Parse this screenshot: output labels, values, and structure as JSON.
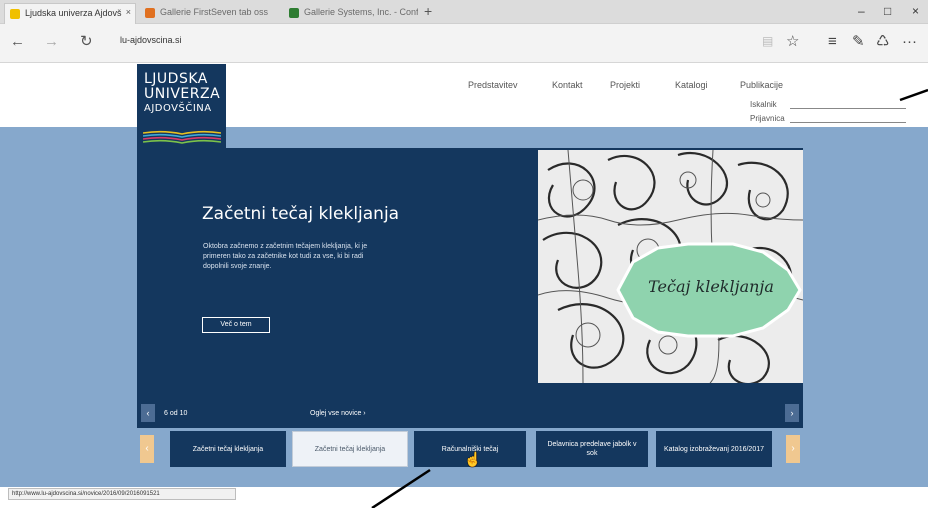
{
  "browser": {
    "tabs": [
      {
        "title": "Ljudska univerza Ajdovš",
        "favicon_color": "#f0c000"
      },
      {
        "title": "Gallerie FirstSeven tab oss",
        "favicon_color": "#e07020"
      },
      {
        "title": "Gallerie Systems, Inc. - Conf",
        "favicon_color": "#2e7d32"
      }
    ],
    "new_tab": "+",
    "window_controls": [
      "–",
      "□",
      "×"
    ],
    "back": "←",
    "forward": "→",
    "refresh": "↻",
    "url": "lu-ajdovscina.si",
    "right_icons": [
      "▤",
      "☆",
      "≡",
      "✎",
      "♺",
      "···"
    ]
  },
  "site": {
    "logo": {
      "line1": "LJUDSKA",
      "line2": "UNIVERZA",
      "line3": "AJDOVŠČINA"
    },
    "menu": [
      "Predstavitev",
      "Kontakt",
      "Projekti",
      "Katalogi",
      "Publikacije"
    ],
    "login": {
      "user_label": "Iskalnik",
      "pass_label": "Prijavnica"
    }
  },
  "slider": {
    "title": "Začetni tečaj klekljanja",
    "description": "Oktobra začnemo z začetnim tečajem klekljanja, ki je primeren tako za začetnike kot tudi za vse, ki bi radi dopolnili svoje znanje.",
    "more_button": "Več o tem",
    "image_badge": "Tečaj klekljanja",
    "counter": "6 od 10",
    "view_all": "Oglej vse novice ›",
    "prev": "‹",
    "next": "›"
  },
  "thumbnails": [
    {
      "label": "Začetni tečaj klekljanja",
      "style": "dark"
    },
    {
      "label": "Začetni tečaj klekljanja",
      "style": "light"
    },
    {
      "label": "Računalniški tečaj",
      "style": "dark"
    },
    {
      "label": "Delavnica predelave jabolk v sok",
      "style": "dark"
    },
    {
      "label": "Katalog izobraževanj 2016/2017",
      "style": "dark"
    }
  ],
  "status_url": "http://www.lu-ajdovscina.si/novice/2016/09/2016091521",
  "colors": {
    "navy": "#14375e",
    "page_blue": "#86a8cc",
    "badge_green": "#8fd3ae",
    "thumb_arrow": "#f0c890"
  }
}
